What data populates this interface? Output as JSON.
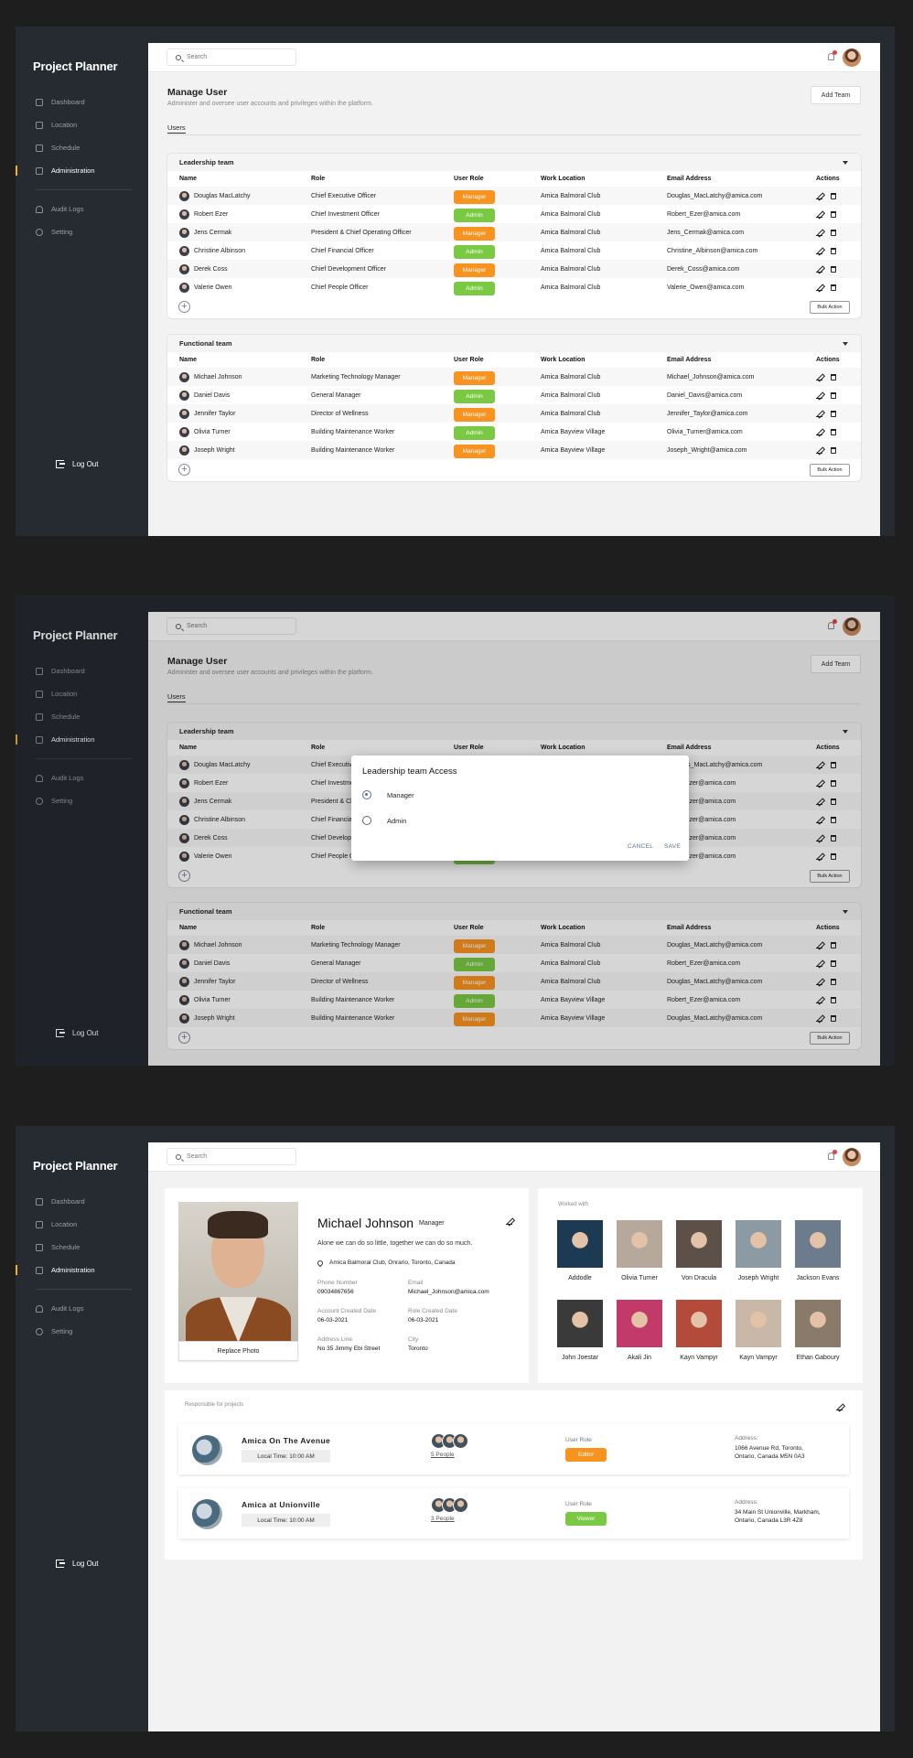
{
  "app": {
    "title": "Project Planner"
  },
  "nav": {
    "items": [
      "Dashboard",
      "Location",
      "Schedule",
      "Administration"
    ],
    "secondary": [
      "Audit Logs",
      "Setting"
    ],
    "logout": "Log Out"
  },
  "search": {
    "placeholder": "Search"
  },
  "page": {
    "title": "Manage User",
    "subtitle": "Administer and oversee user accounts and privileges within the platform.",
    "add_team": "Add Team",
    "tab": "Users"
  },
  "columns": [
    "Name",
    "Role",
    "User Role",
    "Work Location",
    "Email Address",
    "Actions"
  ],
  "leadership": {
    "title": "Leadership team",
    "rows": [
      {
        "name": "Douglas MacLatchy",
        "role": "Chief Executive Officer",
        "user_role": "Manager",
        "loc": "Amica Balmoral Club",
        "email": "Douglas_MacLatchy@amica.com"
      },
      {
        "name": "Robert Ezer",
        "role": "Chief Investment Officer",
        "user_role": "Admin",
        "loc": "Amica Balmoral Club",
        "email": "Robert_Ezer@amica.com"
      },
      {
        "name": "Jens Cermak",
        "role": "President & Chief Operating Officer",
        "user_role": "Manager",
        "loc": "Amica Balmoral Club",
        "email": "Jens_Cermak@amica.com"
      },
      {
        "name": "Christine Albinson",
        "role": "Chief Financial Officer",
        "user_role": "Admin",
        "loc": "Amica Balmoral Club",
        "email": "Christine_Albinson@amica.com"
      },
      {
        "name": "Derek Coss",
        "role": "Chief Development Officer",
        "user_role": "Manager",
        "loc": "Amica Balmoral Club",
        "email": "Derek_Coss@amica.com"
      },
      {
        "name": "Valerie Owen",
        "role": "Chief People Officer",
        "user_role": "Admin",
        "loc": "Amica Balmoral Club",
        "email": "Valerie_Owen@amica.com"
      }
    ]
  },
  "functional": {
    "title": "Functional team",
    "rows": [
      {
        "name": "Michael Johnson",
        "role": "Marketing Technology Manager",
        "user_role": "Manager",
        "loc": "Amica Balmoral Club",
        "email": "Michael_Johnson@amica.com"
      },
      {
        "name": "Daniel Davis",
        "role": "General Manager",
        "user_role": "Admin",
        "loc": "Amica Balmoral Club",
        "email": "Daniel_Davis@amica.com"
      },
      {
        "name": "Jennifer Taylor",
        "role": "Director of Wellness",
        "user_role": "Manager",
        "loc": "Amica Balmoral Club",
        "email": "Jennifer_Taylor@amica.com"
      },
      {
        "name": "Olivia Turner",
        "role": "Building Maintenance Worker",
        "user_role": "Admin",
        "loc": "Amica Bayview Village",
        "email": "Olivia_Turner@amica.com"
      },
      {
        "name": "Joseph Wright",
        "role": "Building Maintenance Worker",
        "user_role": "Manager",
        "loc": "Amica Bayview Village",
        "email": "Joseph_Wright@amica.com"
      }
    ]
  },
  "functional2_emails": [
    "Douglas_MacLatchy@amica.com",
    "Robert_Ezer@amica.com",
    "Douglas_MacLatchy@amica.com",
    "Robert_Ezer@amica.com",
    "Douglas_MacLatchy@amica.com"
  ],
  "leadership2_emails": [
    "Douglas_MacLatchy@amica.com",
    "obert_Ezer@amica.com",
    "obert_Ezer@amica.com",
    "obert_Ezer@amica.com",
    "obert_Ezer@amica.com",
    "obert_Ezer@amica.com"
  ],
  "bulk_action": "Bulk Action",
  "dialog": {
    "title": "Leadership team Access",
    "options": [
      "Manager",
      "Admin"
    ],
    "selected": "Manager",
    "cancel": "CANCEL",
    "save": "SAVE"
  },
  "profile": {
    "name": "Michael Johnson",
    "role": "Manager",
    "quote": "Alone we can do so little, together we can do so much.",
    "location": "Amica Balmoral Club, Onrario, Toronto, Canada",
    "replace_photo": "Replace Photo",
    "fields": [
      {
        "label": "Phone Number",
        "value": "09034867656"
      },
      {
        "label": "Email",
        "value": "Michael_Johnson@amica.com"
      },
      {
        "label": "Account Created Date",
        "value": "06-03-2021"
      },
      {
        "label": "Role Created Date",
        "value": "06-03-2021"
      },
      {
        "label": "Address Line",
        "value": "No 35 Jimmy Ebi Street"
      },
      {
        "label": "City",
        "value": "Toronto"
      }
    ]
  },
  "worked_with": {
    "title": "Worked with",
    "people": [
      "Addodle",
      "Olivia Turner",
      "Von Dracula",
      "Joseph Wright",
      "Jackson Evans",
      "John Joestar",
      "Akali Jin",
      "Kayn Vampyr",
      "Kayn Vampyr",
      "Ethan Gaboury"
    ]
  },
  "responsible": {
    "title": "Responsible for projects",
    "projects": [
      {
        "name": "Amica On The Avenue",
        "local_time": "Local Time: 10:00 AM",
        "people": "5 People",
        "user_role_label": "User Role",
        "user_role": "Editor",
        "role_color": "#f7931e",
        "address_label": "Address:",
        "address1": "1066 Avenue Rd, Toronto,",
        "address2": "Ontario, Canada M5N 0A3"
      },
      {
        "name": "Amica at Unionville",
        "local_time": "Local Time: 10:00 AM",
        "people": "3 People",
        "user_role_label": "User Role",
        "user_role": "Viewer",
        "role_color": "#7ac943",
        "address_label": "Address:",
        "address1": "34 Main St Unionville, Markham,",
        "address2": "Ontario, Canada L3R 4Z8"
      }
    ]
  }
}
